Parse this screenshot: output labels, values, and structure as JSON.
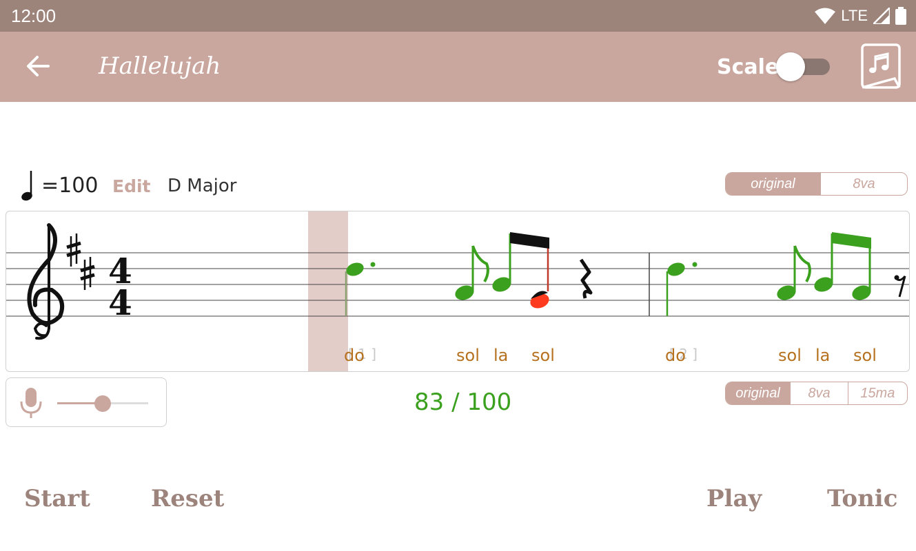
{
  "status_bar": {
    "time": "12:00",
    "network": "LTE"
  },
  "app_bar": {
    "title": "Hallelujah",
    "scale_label": "Scale",
    "scale_on": false
  },
  "tempo": {
    "symbol": "=",
    "bpm": "100",
    "edit_label": "Edit",
    "key": "D Major"
  },
  "octave_top": {
    "options": [
      "original",
      "8va"
    ],
    "selected": "original"
  },
  "staff": {
    "measure_numbers": [
      "[ 1 ]",
      "[ 2 ]"
    ],
    "solfege": [
      "do",
      "sol",
      "la",
      "sol",
      "do",
      "sol",
      "la",
      "sol"
    ]
  },
  "mic": {
    "level": 0.5
  },
  "score": {
    "text": "83 / 100",
    "value": 83,
    "max": 100
  },
  "octave_bottom": {
    "options": [
      "original",
      "8va",
      "15ma"
    ],
    "selected": "original"
  },
  "buttons": {
    "start": "Start",
    "reset": "Reset",
    "play": "Play",
    "tonic": "Tonic"
  },
  "colors": {
    "accent": "#c9a79f",
    "statusbar": "#9d847b",
    "correct": "#3ba01e",
    "wrong": "#ff3b1f",
    "solfege": "#b6711e",
    "button_text": "#9c847c"
  }
}
